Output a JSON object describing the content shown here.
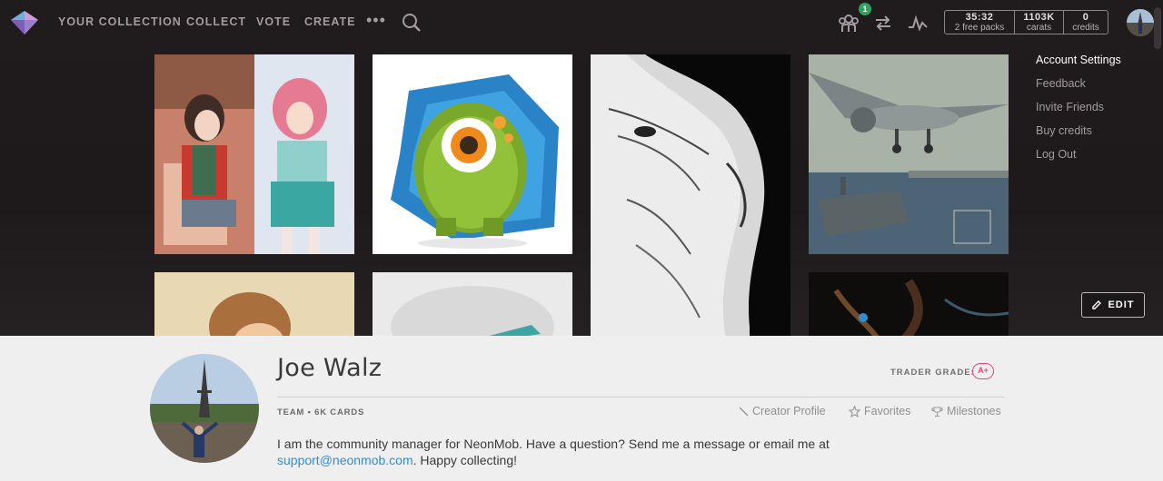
{
  "nav": {
    "items": [
      "YOUR COLLECTION",
      "COLLECT",
      "VOTE",
      "CREATE"
    ],
    "more_glyph": "•••",
    "badge_count": "1"
  },
  "stats": {
    "timer_value": "35:32",
    "timer_label": "2 free packs",
    "carats_value": "1103K",
    "carats_label": "carats",
    "credits_value": "0",
    "credits_label": "credits"
  },
  "account_menu": [
    "Account Settings",
    "Feedback",
    "Invite Friends",
    "Buy credits",
    "Log Out"
  ],
  "edit_label": "EDIT",
  "profile": {
    "name": "Joe Walz",
    "trader_grade_label": "TRADER GRADE:",
    "trader_grade": "A+",
    "meta": "TEAM • 6K CARDS",
    "links": [
      "Creator Profile",
      "Favorites",
      "Milestones"
    ],
    "bio_text": "I am the community manager for NeonMob. Have a question? Send me a message or email me at",
    "bio_email": "support@neonmob.com",
    "bio_end": ". Happy collecting!"
  },
  "colors": {
    "header_bg": "#1e1a1c",
    "accent_link": "#2f8ecf",
    "grade_pink": "#e24a7b",
    "badge_green": "#2ca55e"
  },
  "icons": [
    "logo-gem-icon",
    "search-icon",
    "people-icon",
    "trade-arrows-icon",
    "activity-icon",
    "pencil-icon",
    "wand-icon",
    "star-icon",
    "trophy-icon"
  ]
}
